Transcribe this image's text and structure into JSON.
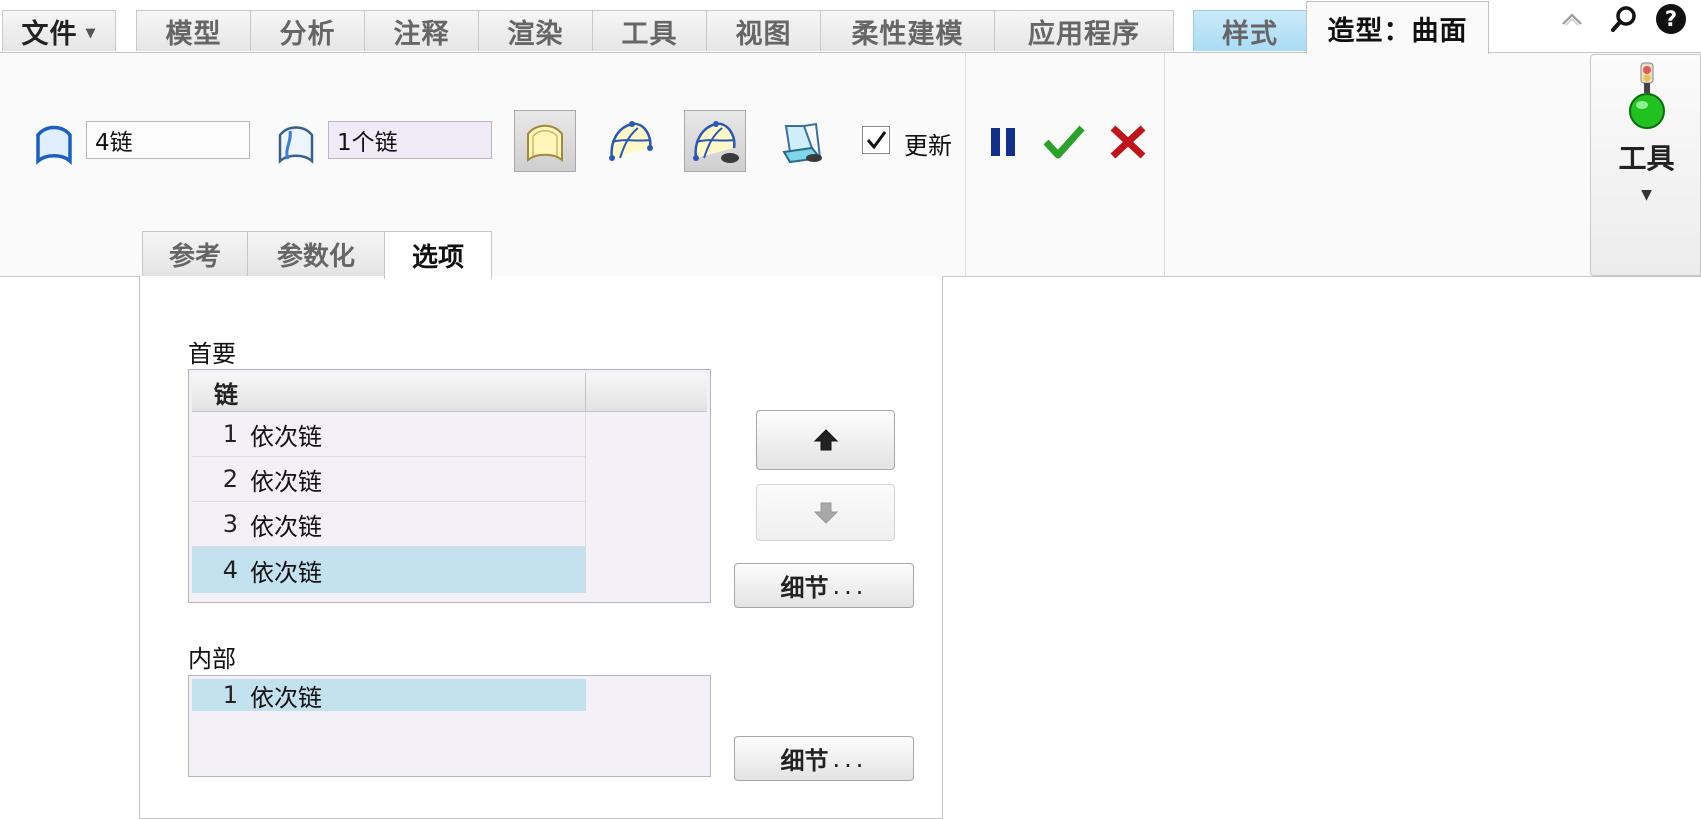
{
  "tabs": {
    "file": "文件",
    "model": "模型",
    "analysis": "分析",
    "annotate": "注释",
    "render": "渲染",
    "tools": "工具",
    "view": "视图",
    "flexible_modeling": "柔性建模",
    "applications": "应用程序",
    "style": "样式",
    "style_surface": "造型：曲面"
  },
  "ribbon": {
    "primary_chains_value": "4链",
    "internal_chains_value": "1个链",
    "update_label": "更新",
    "update_checked": true,
    "tools_button_label": "工具"
  },
  "subtabs": {
    "references": "参考",
    "parameterization": "参数化",
    "options": "选项"
  },
  "options_panel": {
    "primary_label": "首要",
    "chain_column_header": "链",
    "primary_rows": [
      {
        "index": "1",
        "name": "依次链"
      },
      {
        "index": "2",
        "name": "依次链"
      },
      {
        "index": "3",
        "name": "依次链"
      },
      {
        "index": "4",
        "name": "依次链"
      }
    ],
    "primary_selected_index": 4,
    "internal_label": "内部",
    "internal_rows": [
      {
        "index": "1",
        "name": "依次链"
      }
    ],
    "details_label": "细节",
    "details_dots": "..."
  },
  "colors": {
    "style_tab": "#a9dcf5",
    "selected_row": "#c3e1ef",
    "list_bg": "#f4f0f8",
    "ok_green": "#2aa12a",
    "cancel_red": "#c0151b",
    "pause_blue": "#12308a"
  },
  "icons": {
    "primary_chain": "surface-boundary-icon",
    "internal_chain": "internal-curve-icon",
    "minimize": "chevron-up-icon",
    "search": "search-icon",
    "help": "help-icon",
    "pause": "pause-icon",
    "ok": "checkmark-icon",
    "cancel": "close-icon",
    "tools": "traffic-light-icon"
  }
}
